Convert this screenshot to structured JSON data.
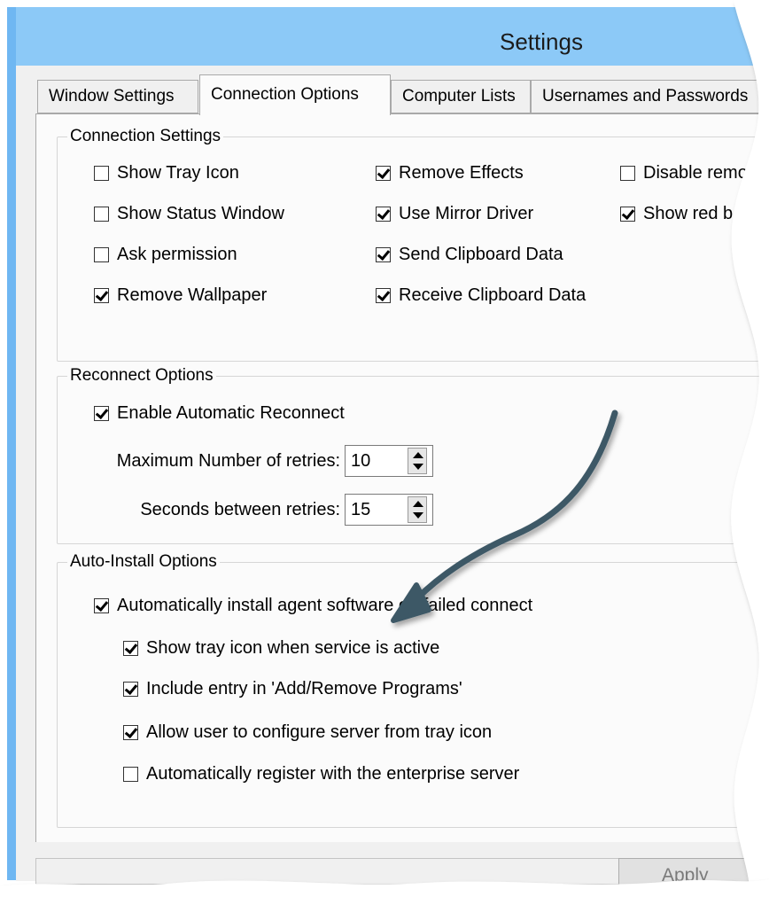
{
  "window": {
    "title": "Settings"
  },
  "tabs": [
    {
      "label": "Window Settings"
    },
    {
      "label": "Connection Options"
    },
    {
      "label": "Computer Lists"
    },
    {
      "label": "Usernames and Passwords"
    }
  ],
  "connection_settings": {
    "title": "Connection Settings",
    "items": [
      {
        "label": "Show Tray Icon",
        "checked": false
      },
      {
        "label": "Show Status Window",
        "checked": false
      },
      {
        "label": "Ask permission",
        "checked": false
      },
      {
        "label": "Remove Wallpaper",
        "checked": true
      },
      {
        "label": "Remove Effects",
        "checked": true
      },
      {
        "label": "Use Mirror Driver",
        "checked": true
      },
      {
        "label": "Send Clipboard Data",
        "checked": true
      },
      {
        "label": "Receive Clipboard Data",
        "checked": true
      },
      {
        "label": "Disable remote",
        "checked": false
      },
      {
        "label": "Show red bar",
        "checked": true
      }
    ]
  },
  "reconnect_options": {
    "title": "Reconnect Options",
    "enable": {
      "label": "Enable Automatic Reconnect",
      "checked": true
    },
    "max_retries": {
      "label": "Maximum Number of retries:",
      "value": "10"
    },
    "seconds_between": {
      "label": "Seconds between retries:",
      "value": "15"
    }
  },
  "auto_install": {
    "title": "Auto-Install Options",
    "items": [
      {
        "label": "Automatically install agent software on failed connect",
        "checked": true
      },
      {
        "label": "Show tray icon when service is active",
        "checked": true
      },
      {
        "label": "Include entry in 'Add/Remove Programs'",
        "checked": true
      },
      {
        "label": "Allow user to configure server from tray icon",
        "checked": true
      },
      {
        "label": "Automatically register with the enterprise server",
        "checked": false
      }
    ]
  },
  "buttons": {
    "apply": "Apply"
  },
  "colors": {
    "titlebar": "#8cc9f7",
    "frame": "#6fb7f2",
    "arrow": "#3e5866"
  }
}
